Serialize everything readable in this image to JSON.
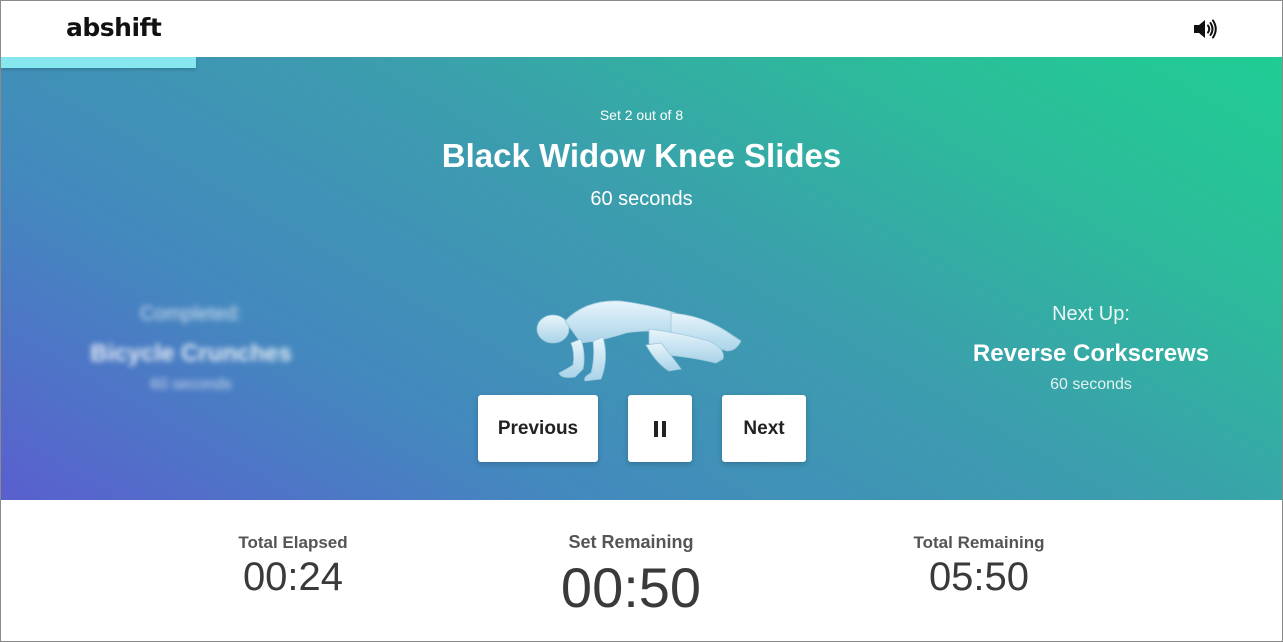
{
  "header": {
    "logo": "abshift",
    "sound_icon": "speaker-volume-icon"
  },
  "workout": {
    "progress_fraction": 0.152,
    "set_count": "Set 2 out of 8",
    "exercise": "Black Widow Knee Slides",
    "duration": "60 seconds",
    "completed": {
      "label": "Completed:",
      "name": "Bicycle Crunches",
      "duration": "60 seconds"
    },
    "next_up": {
      "label": "Next Up:",
      "name": "Reverse Corkscrews",
      "duration": "60 seconds"
    }
  },
  "controls": {
    "previous_label": "Previous",
    "pause_icon": "pause-icon",
    "next_label": "Next"
  },
  "stats": {
    "total_elapsed": {
      "label": "Total Elapsed",
      "value": "00:24"
    },
    "set_remaining": {
      "label": "Set Remaining",
      "value": "00:50"
    },
    "total_remaining": {
      "label": "Total Remaining",
      "value": "05:50"
    }
  },
  "colors": {
    "gradient_start": "#5a5fcf",
    "gradient_end": "#20cd94",
    "progress": "#86e8ee"
  }
}
